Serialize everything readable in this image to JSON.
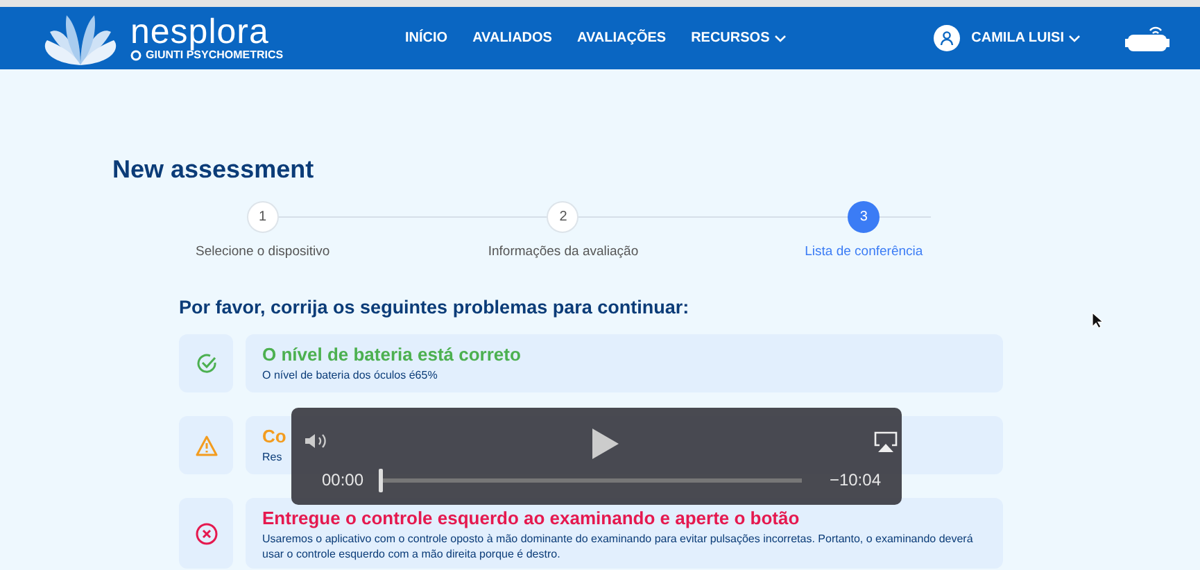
{
  "header": {
    "brand": "nesplora",
    "sub_brand": "GIUNTI PSYCHOMETRICS",
    "nav": [
      {
        "label": "INÍCIO",
        "has_menu": false
      },
      {
        "label": "AVALIADOS",
        "has_menu": false
      },
      {
        "label": "AVALIAÇÕES",
        "has_menu": false
      },
      {
        "label": "RECURSOS",
        "has_menu": true
      }
    ],
    "user": "CAMILA LUISI"
  },
  "title": "New assessment",
  "steps": [
    {
      "number": "1",
      "label": "Selecione o dispositivo",
      "selected": false
    },
    {
      "number": "2",
      "label": "Informações da avaliação",
      "selected": false
    },
    {
      "number": "3",
      "label": "Lista de conferência",
      "selected": true
    }
  ],
  "heading": "Por favor, corrija os seguintes problemas para continuar:",
  "checks": [
    {
      "kind": "success",
      "title": "O nível de bateria está correto",
      "text": "O nível de bateria dos óculos é65%"
    },
    {
      "kind": "warning",
      "title": "Co",
      "text": "Res"
    },
    {
      "kind": "error",
      "title": "Entregue o controle esquerdo ao examinando e aperte o botão",
      "text": "Usaremos o aplicativo com o controle oposto à mão dominante do examinando para evitar pulsações incorretas. Portanto, o examinando deverá usar o controle esquerdo com a mão direita porque é destro."
    }
  ],
  "video": {
    "current": "00:00",
    "remaining": "−10:04",
    "level": 0
  }
}
